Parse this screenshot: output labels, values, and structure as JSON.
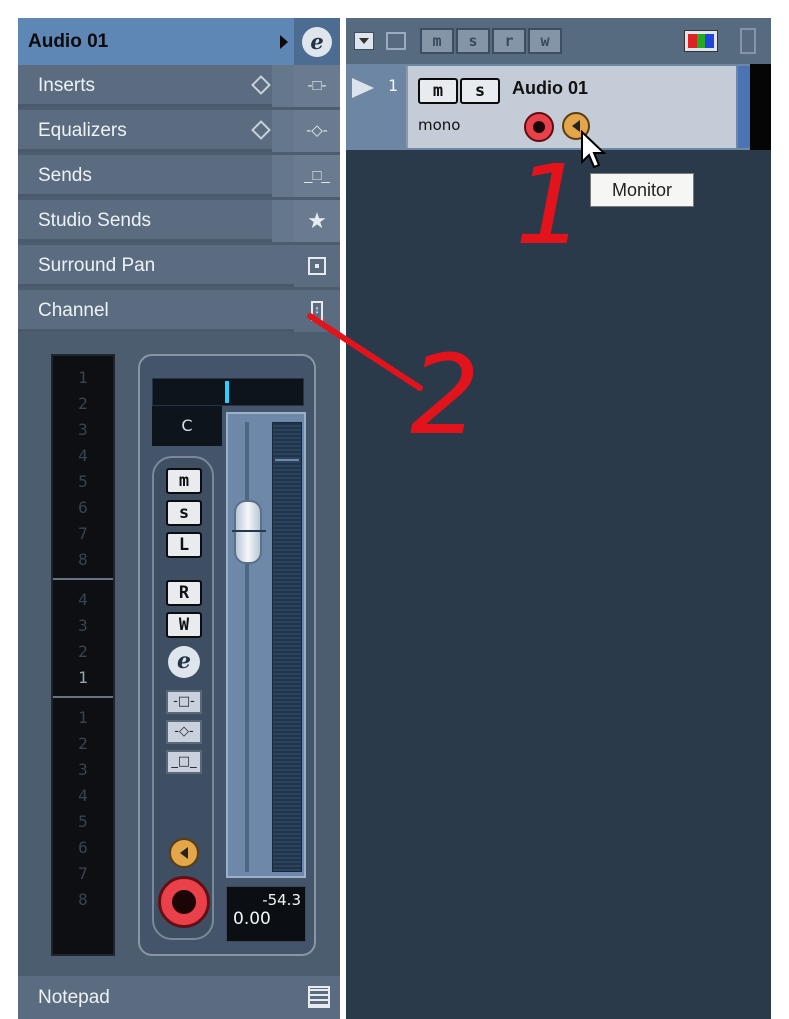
{
  "inspector": {
    "title": "Audio 01",
    "edit_icon": "e",
    "sections": [
      {
        "label": "Inserts",
        "icon": "insert-icon"
      },
      {
        "label": "Equalizers",
        "icon": "eq-icon"
      },
      {
        "label": "Sends",
        "icon": "sends-icon"
      },
      {
        "label": "Studio Sends",
        "icon": "star-icon"
      },
      {
        "label": "Surround Pan",
        "icon": "surround-icon"
      },
      {
        "label": "Channel",
        "icon": "channel-icon"
      }
    ],
    "notepad": "Notepad"
  },
  "channel_strip": {
    "meter_left_top": [
      "1",
      "2",
      "3",
      "4",
      "5",
      "6",
      "7",
      "8"
    ],
    "meter_left_mid": [
      "4",
      "3",
      "2",
      "1"
    ],
    "meter_left_bot": [
      "1",
      "2",
      "3",
      "4",
      "5",
      "6",
      "7",
      "8"
    ],
    "pan_value": "C",
    "buttons": {
      "mute": "m",
      "solo": "s",
      "listen": "L",
      "read": "R",
      "write": "W",
      "edit": "e"
    },
    "peak": "-54.3",
    "gain": "0.00"
  },
  "project": {
    "toolbar": [
      "m",
      "s",
      "r",
      "w"
    ],
    "track": {
      "number": "1",
      "name": "Audio 01",
      "mode": "mono",
      "mute": "m",
      "solo": "s"
    }
  },
  "tooltip": "Monitor",
  "annotations": {
    "one": "1",
    "two": "2"
  },
  "colors": {
    "record": "#e9404a",
    "monitor": "#e3a64a",
    "selected": "#5f87b5",
    "meter_mark": "#2ad0ff",
    "annotation": "#e3131c"
  }
}
